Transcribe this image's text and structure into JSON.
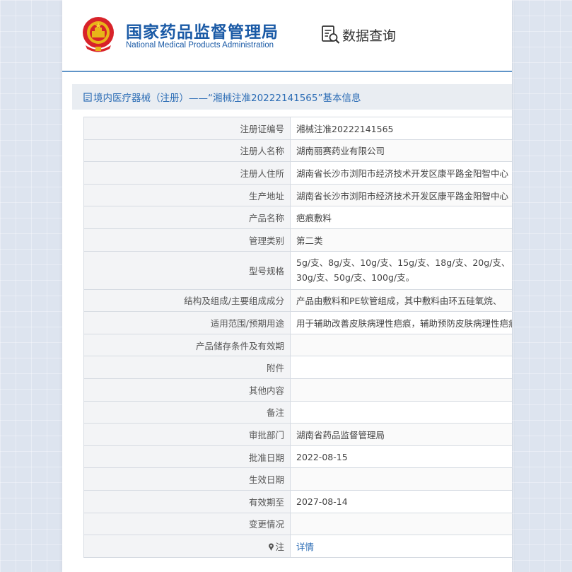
{
  "header": {
    "org_name_cn": "国家药品监督管理局",
    "org_name_en": "National Medical Products Administration",
    "data_query_label": "数据查询"
  },
  "breadcrumb": {
    "text": "境内医疗器械（注册）——“湘械注准20222141565”基本信息"
  },
  "rows": [
    {
      "label": "注册证编号",
      "value": "湘械注准20222141565"
    },
    {
      "label": "注册人名称",
      "value": "湖南丽赛药业有限公司"
    },
    {
      "label": "注册人住所",
      "value": "湖南省长沙市浏阳市经济技术开发区康平路金阳智中心"
    },
    {
      "label": "生产地址",
      "value": "湖南省长沙市浏阳市经济技术开发区康平路金阳智中心"
    },
    {
      "label": "产品名称",
      "value": "疤痕敷料"
    },
    {
      "label": "管理类别",
      "value": "第二类"
    },
    {
      "label": "型号规格",
      "value": "5g/支、8g/支、10g/支、15g/支、18g/支、20g/支、30g/支、50g/支、100g/支。"
    },
    {
      "label": "结构及组成/主要组成成分",
      "value": "产品由敷料和PE软管组成，其中敷料由环五硅氧烷、"
    },
    {
      "label": "适用范围/预期用途",
      "value": "用于辅助改善皮肤病理性疤痕，辅助预防皮肤病理性疤痕"
    },
    {
      "label": "产品储存条件及有效期",
      "value": ""
    },
    {
      "label": "附件",
      "value": ""
    },
    {
      "label": "其他内容",
      "value": ""
    },
    {
      "label": "备注",
      "value": ""
    },
    {
      "label": "审批部门",
      "value": "湖南省药品监督管理局"
    },
    {
      "label": "批准日期",
      "value": "2022-08-15"
    },
    {
      "label": "生效日期",
      "value": ""
    },
    {
      "label": "有效期至",
      "value": "2027-08-14"
    },
    {
      "label": "变更情况",
      "value": ""
    }
  ],
  "note_row": {
    "label": "注",
    "link_text": "详情"
  },
  "colors": {
    "brand_blue": "#1a5aa6",
    "link_blue": "#2b6cb5",
    "header_rule": "#5f94c8"
  },
  "icons": [
    "national-emblem-icon",
    "data-search-icon",
    "document-icon",
    "pin-icon"
  ]
}
